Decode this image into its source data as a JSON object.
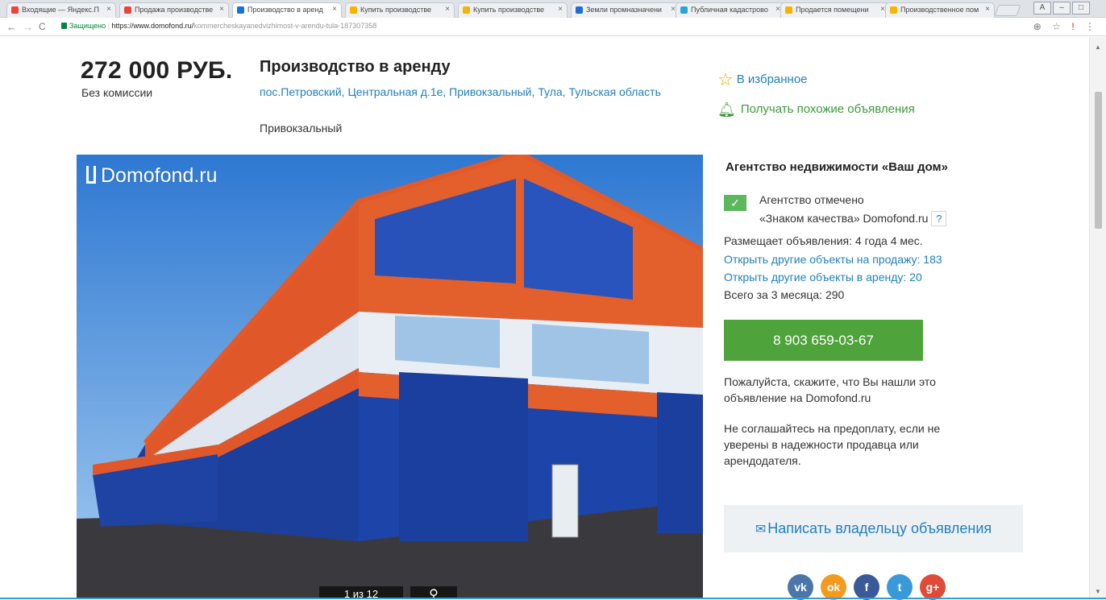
{
  "browser": {
    "tabs": [
      {
        "label": "Входящие — Яндекс.П",
        "color": "#e9463b"
      },
      {
        "label": "Продажа производстве",
        "color": "#e9463b"
      },
      {
        "label": "Производство в аренд",
        "color": "#1f6fd1"
      },
      {
        "label": "Купить производстве",
        "color": "#f4b400"
      },
      {
        "label": "Купить производстве",
        "color": "#f4b400"
      },
      {
        "label": "Земли промназначени",
        "color": "#1f6fd1"
      },
      {
        "label": "Публичная кадастрово",
        "color": "#2aa4d8"
      },
      {
        "label": "Продается помещени",
        "color": "#f4b400"
      },
      {
        "label": "Производственное пом",
        "color": "#f4b400"
      }
    ],
    "secure_label": "Защищено",
    "url_host": "https://www.domofond.ru/",
    "url_path": "kommercheskayanedvizhimost-v-arendu-tula-187307358"
  },
  "listing": {
    "price": "272 000 РУБ.",
    "commission": "Без комиссии",
    "title": "Производство в аренду",
    "address": "пос.Петровский, Центральная д.1е, Привокзальный, Тула, Тульская область",
    "district": "Привокзальный",
    "favorite_label": "В избранное",
    "similar_label": "Получать похожие объявления"
  },
  "photo": {
    "watermark": "Domofond.ru",
    "counter": "1 из 12"
  },
  "seller": {
    "agency_name": "Агентство недвижимости «Ваш дом»",
    "quality_line1": "Агентство отмечено",
    "quality_line2": "«Знаком качества» Domofond.ru",
    "quality_help": "?",
    "duration": "Размещает объявления: 4 года 4 мес.",
    "sale_link": "Открыть другие объекты на продажу: 183",
    "rent_link": "Открыть другие объекты в аренду: 20",
    "total": "Всего за 3 месяца: 290",
    "phone": "8 903 659-03-67",
    "note1": "Пожалуйста, скажите, что Вы нашли это объявление на Domofond.ru",
    "note2": "Не соглашайтесь на предоплату, если не уверены в надежности продавца или арендодателя.",
    "write_label": "Написать владельцу объявления"
  },
  "social": [
    {
      "name": "vk",
      "label": "vk",
      "color": "#4a76a8"
    },
    {
      "name": "odnoklassniki",
      "label": "ok",
      "color": "#f39a1f"
    },
    {
      "name": "facebook",
      "label": "f",
      "color": "#3b5998"
    },
    {
      "name": "twitter",
      "label": "t",
      "color": "#3a9ad9"
    },
    {
      "name": "google-plus",
      "label": "g+",
      "color": "#dd4b39"
    }
  ]
}
